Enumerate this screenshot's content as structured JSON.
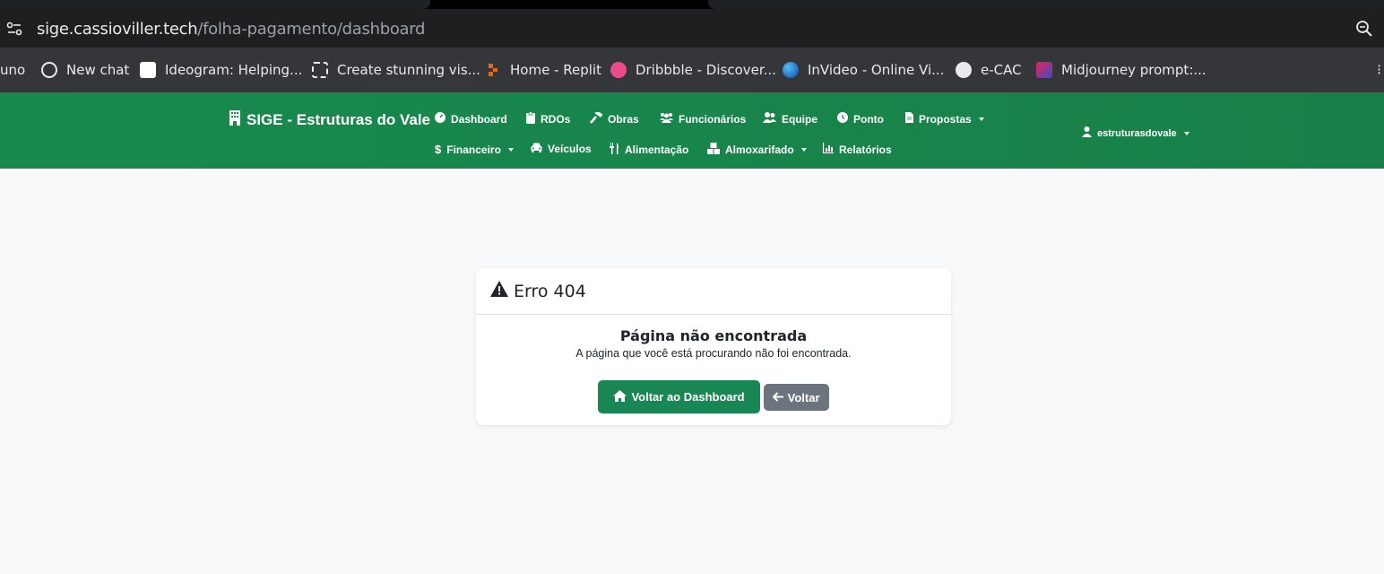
{
  "browser": {
    "url_host": "sige.cassioviller.tech",
    "url_path": "/folha-pagamento/dashboard",
    "bookmarks": [
      {
        "label": "uno",
        "icon": "none"
      },
      {
        "label": "New chat",
        "icon": "openai-icon"
      },
      {
        "label": "Ideogram: Helping...",
        "icon": "ideogram-icon"
      },
      {
        "label": "Create stunning vis...",
        "icon": "frame-icon"
      },
      {
        "label": "Home - Replit",
        "icon": "replit-icon"
      },
      {
        "label": "Dribbble - Discover...",
        "icon": "dribbble-icon"
      },
      {
        "label": "InVideo - Online Vi...",
        "icon": "invideo-icon"
      },
      {
        "label": "e-CAC",
        "icon": "globe-icon"
      },
      {
        "label": "Midjourney prompt:...",
        "icon": "midjourney-icon"
      }
    ]
  },
  "navbar": {
    "brand": "SIGE - Estruturas do Vale",
    "items_row1": [
      {
        "label": "Dashboard",
        "icon": "gauge-icon"
      },
      {
        "label": "RDOs",
        "icon": "clipboard-icon"
      },
      {
        "label": "Obras",
        "icon": "hammer-icon"
      },
      {
        "label": "Funcionários",
        "icon": "users-icon"
      },
      {
        "label": "Equipe",
        "icon": "user-group-icon"
      },
      {
        "label": "Ponto",
        "icon": "clock-icon"
      },
      {
        "label": "Propostas",
        "icon": "file-icon",
        "dropdown": true
      }
    ],
    "items_row2": [
      {
        "label": "Financeiro",
        "icon": "dollar-icon",
        "dropdown": true
      },
      {
        "label": "Veículos",
        "icon": "car-icon"
      },
      {
        "label": "Alimentação",
        "icon": "utensils-icon"
      },
      {
        "label": "Almoxarifado",
        "icon": "boxes-icon",
        "dropdown": true
      },
      {
        "label": "Relatórios",
        "icon": "chart-icon"
      }
    ],
    "user": "estruturasdovale"
  },
  "error_card": {
    "title": "Erro 404",
    "heading": "Página não encontrada",
    "message": "A página que você está procurando não foi encontrada.",
    "primary_button": "Voltar ao Dashboard",
    "secondary_button": "Voltar"
  },
  "colors": {
    "navbar": "#198754",
    "primary": "#198754",
    "secondary": "#6c757d",
    "page_bg": "#f8f9fa"
  }
}
